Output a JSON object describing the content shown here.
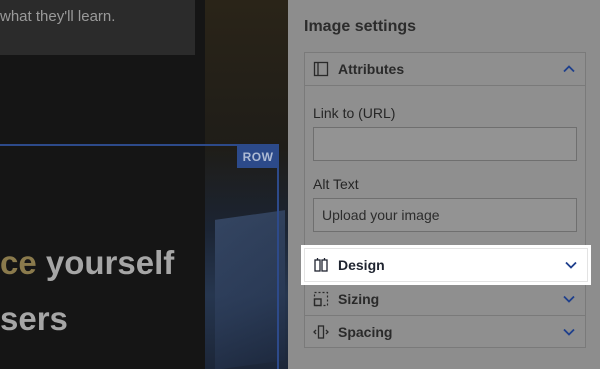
{
  "canvas": {
    "intro_text": "what they'll learn.",
    "row_badge": "ROW",
    "heading_line1_accent": "ce",
    "heading_line1_rest": " yourself",
    "heading_line2": "sers"
  },
  "panel": {
    "title": "Image settings",
    "attributes": {
      "label": "Attributes",
      "icon": "panel-layout-icon",
      "expanded": true,
      "link_label": "Link to (URL)",
      "link_value": "",
      "alt_label": "Alt Text",
      "alt_value": "Upload your image"
    },
    "design": {
      "label": "Design",
      "icon": "design-columns-icon",
      "expanded": false
    },
    "sizing": {
      "label": "Sizing",
      "icon": "sizing-icon",
      "expanded": false
    },
    "spacing": {
      "label": "Spacing",
      "icon": "spacing-icon",
      "expanded": false
    }
  },
  "colors": {
    "accent_blue": "#2c4a8a",
    "chevron_blue": "#1e3f8c",
    "panel_bg": "#8d8d8d",
    "highlight_bg": "#ffffff"
  }
}
